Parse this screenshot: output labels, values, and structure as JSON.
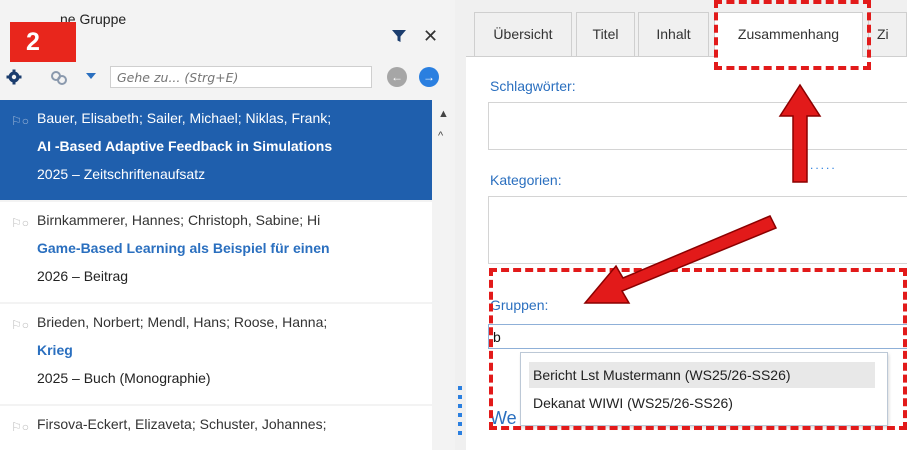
{
  "step_badge": "2",
  "left_panel": {
    "group_title": "ne Gruppe",
    "goto_placeholder": "Gehe zu... (Strg+E)",
    "items": [
      {
        "authors": "Bauer, Elisabeth; Sailer, Michael; Niklas, Frank;",
        "title": "AI -Based Adaptive Feedback in Simulations",
        "meta": "2025 – Zeitschriftenaufsatz",
        "selected": true
      },
      {
        "authors": "Birnkammerer, Hannes; Christoph, Sabine; Hi",
        "title": "Game-Based Learning als Beispiel für einen",
        "meta": "2026 – Beitrag",
        "selected": false
      },
      {
        "authors": "Brieden, Norbert; Mendl, Hans; Roose, Hanna;",
        "title": "Krieg",
        "meta": "2025 – Buch (Monographie)",
        "selected": false
      },
      {
        "authors": "Firsova-Eckert, Elizaveta; Schuster, Johannes;",
        "title": "",
        "meta": "",
        "selected": false
      }
    ]
  },
  "tabs": [
    {
      "label": "Übersicht"
    },
    {
      "label": "Titel"
    },
    {
      "label": "Inhalt"
    },
    {
      "label": "Zusammenhang",
      "active": true
    },
    {
      "label": "Zi"
    }
  ],
  "form": {
    "keywords_label": "Schlagwörter:",
    "categories_label": "Kategorien:",
    "groups_label": "Gruppen:",
    "groups_value": "b",
    "suggestions": [
      "Bericht Lst Mustermann (WS25/26-SS26)",
      "Dekanat WIWI (WS25/26-SS26)"
    ],
    "more_text": "We"
  },
  "colors": {
    "annotation": "#e21a1a",
    "accent": "#2a6fbf",
    "selection": "#1f5fad"
  }
}
